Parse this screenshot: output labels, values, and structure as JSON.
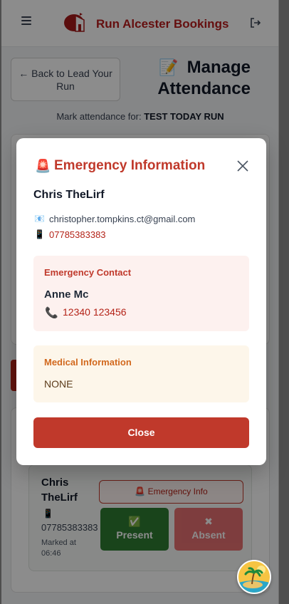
{
  "header": {
    "brand": "Run Alcester Bookings",
    "menu_icon": "hamburger-icon",
    "logo_icon": "run-alcester-logo",
    "logout_icon": "logout-icon"
  },
  "page": {
    "back_button_label": "← Back to Lead Your Run",
    "title_icon": "memo-icon",
    "title": "Manage Attendance",
    "mark_for_prefix": "Mark attendance for:",
    "run_name": "TEST TODAY RUN"
  },
  "attendee_card": {
    "name": "Chris TheLirf",
    "phone": "07785383383",
    "marked_at": "Marked at 06:46",
    "emergency_button": "🚨 Emergency Info",
    "present_label": "Present",
    "absent_label": "Absent"
  },
  "modal": {
    "title": "Emergency Information",
    "title_icon": "siren-icon",
    "runner_name": "Chris TheLirf",
    "email": "christopher.tompkins.ct@gmail.com",
    "phone": "07785383383",
    "emergency_contact": {
      "heading": "Emergency Contact",
      "name": "Anne Mc",
      "phone": "12340 123456"
    },
    "medical": {
      "heading": "Medical Information",
      "value": "NONE"
    },
    "close_label": "Close"
  },
  "colors": {
    "brand_red": "#c0392b",
    "present_green": "#2e7d32",
    "absent_red": "#e4585a",
    "medical_orange": "#d2691e"
  }
}
